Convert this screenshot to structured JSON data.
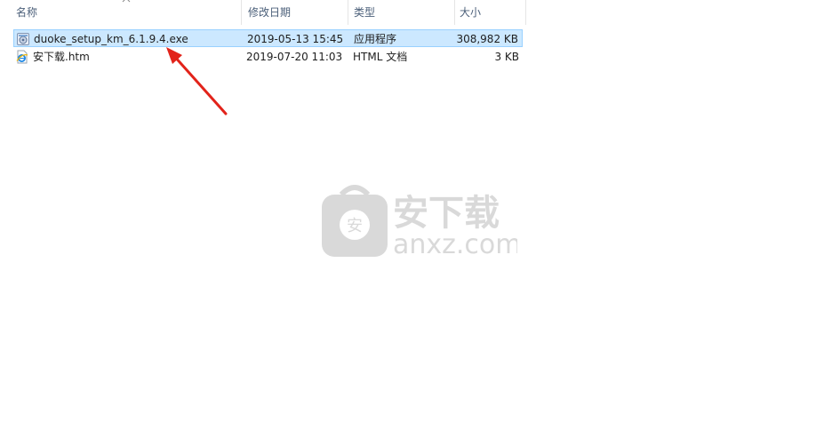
{
  "columns": {
    "name": "名称",
    "modified": "修改日期",
    "type": "类型",
    "size": "大小"
  },
  "files": [
    {
      "name": "duoke_setup_km_6.1.9.4.exe",
      "modified": "2019-05-13 15:45",
      "type": "应用程序",
      "size": "308,982 KB",
      "icon": "setup-exe-icon",
      "selected": true
    },
    {
      "name": "安下载.htm",
      "modified": "2019-07-20 11:03",
      "type": "HTML 文档",
      "size": "3 KB",
      "icon": "ie-html-icon",
      "selected": false
    }
  ],
  "watermark": {
    "text_cn": "安下载",
    "text_en": "anxz.com",
    "badge": "安"
  },
  "colors": {
    "selection_bg": "#cce8ff",
    "selection_border": "#99d1ff",
    "header_text": "#4c607a",
    "arrow": "#e2231a"
  }
}
